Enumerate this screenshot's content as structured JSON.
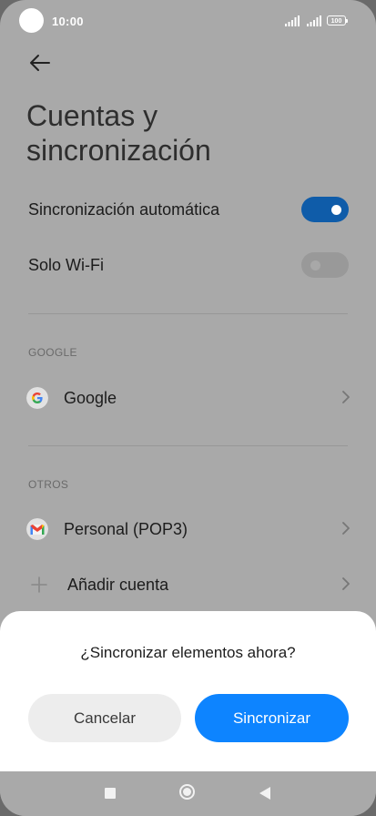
{
  "status_bar": {
    "time": "10:00",
    "battery": "100"
  },
  "header": {
    "title_line1": "Cuentas y",
    "title_line2": "sincronización"
  },
  "settings": {
    "auto_sync": {
      "label": "Sincronización automática",
      "enabled": true
    },
    "wifi_only": {
      "label": "Solo Wi-Fi",
      "enabled": false
    }
  },
  "sections": {
    "google": {
      "header": "GOOGLE",
      "accounts": [
        {
          "label": "Google",
          "icon": "google-icon"
        }
      ]
    },
    "others": {
      "header": "OTROS",
      "accounts": [
        {
          "label": "Personal (POP3)",
          "icon": "gmail-icon"
        }
      ],
      "add_account": {
        "label": "Añadir cuenta",
        "icon": "plus-icon"
      }
    }
  },
  "dialog": {
    "title": "¿Sincronizar elementos ahora?",
    "cancel_label": "Cancelar",
    "confirm_label": "Sincronizar"
  },
  "colors": {
    "accent": "#0d84ff",
    "toggle_on": "#0f5ca9",
    "scrim_background": "#a9a9a9",
    "sheet_background": "#ffffff"
  },
  "nav_bar": {
    "icons": [
      "recents-icon",
      "home-icon",
      "back-icon"
    ]
  }
}
